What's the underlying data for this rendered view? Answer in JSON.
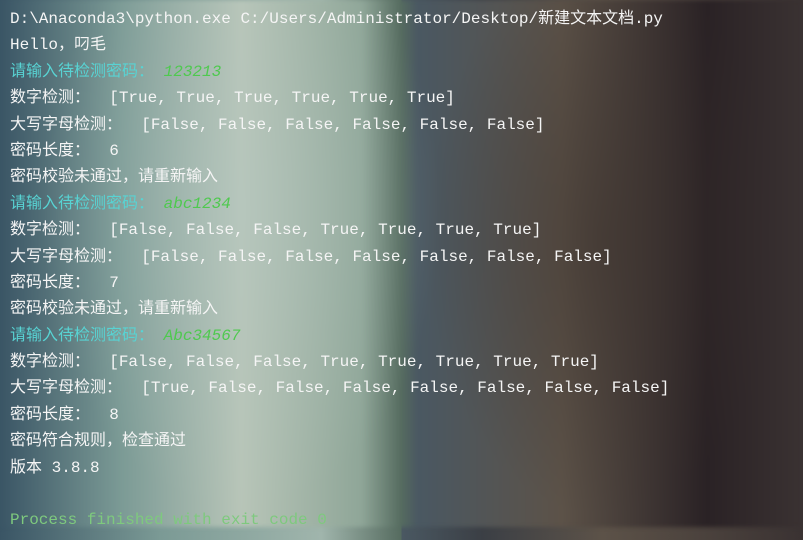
{
  "cmd": "D:\\Anaconda3\\python.exe C:/Users/Administrator/Desktop/新建文本文档.py",
  "greeting": "Hello，叼毛",
  "prompt_label": "请输入待检测密码：",
  "attempts": [
    {
      "input": "123213",
      "digit_label": "数字检测：",
      "digit_result": "[True, True, True, True, True, True]",
      "upper_label": "大写字母检测：",
      "upper_result": "[False, False, False, False, False, False]",
      "length_label": "密码长度：",
      "length_value": "6",
      "msg": "密码校验未通过，请重新输入"
    },
    {
      "input": "abc1234",
      "digit_label": "数字检测：",
      "digit_result": "[False, False, False, True, True, True, True]",
      "upper_label": "大写字母检测：",
      "upper_result": "[False, False, False, False, False, False, False]",
      "length_label": "密码长度：",
      "length_value": "7",
      "msg": "密码校验未通过，请重新输入"
    },
    {
      "input": "Abc34567",
      "digit_label": "数字检测：",
      "digit_result": "[False, False, False, True, True, True, True, True]",
      "upper_label": "大写字母检测：",
      "upper_result": "[True, False, False, False, False, False, False, False]",
      "length_label": "密码长度：",
      "length_value": "8",
      "msg": "密码符合规则，检查通过"
    }
  ],
  "version_label": "版本 ",
  "version_value": "3.8.8",
  "exit_msg": "Process finished with exit code 0"
}
